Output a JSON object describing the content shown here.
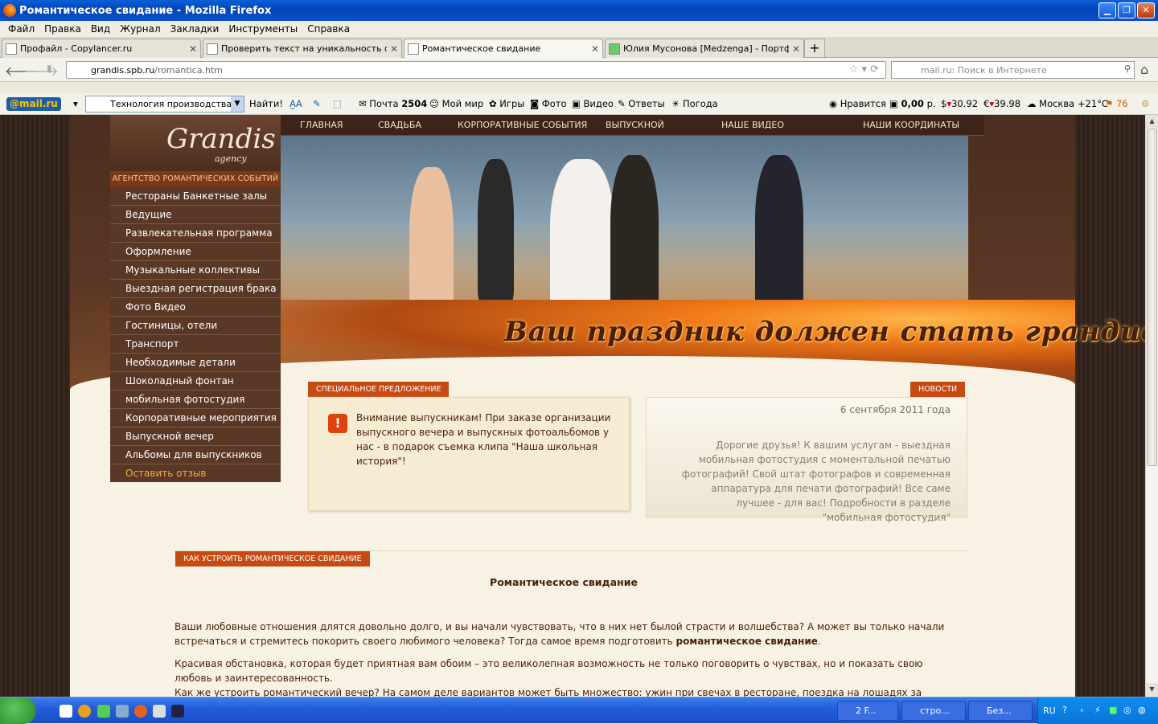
{
  "window": {
    "title": "Романтическое свидание - Mozilla Firefox"
  },
  "menu": [
    "Файл",
    "Правка",
    "Вид",
    "Журнал",
    "Закладки",
    "Инструменты",
    "Справка"
  ],
  "tabs": [
    {
      "label": "Профайл - Copylancer.ru"
    },
    {
      "label": "Проверить текст на уникальность онл..."
    },
    {
      "label": "Романтическое свидание"
    },
    {
      "label": "Юлия Мусонова [Medzenga] - Портфолио"
    }
  ],
  "address": {
    "domain": "grandis.spb.ru",
    "path": "/romantica.htm"
  },
  "search": {
    "placeholder": "mail.ru: Поиск в Интернете"
  },
  "mailru": {
    "logo": "@mail.ru",
    "query": "Технология производства пе",
    "find": "Найти!",
    "mail_label": "Почта",
    "mail_count": "2504",
    "moi_mir": "Мой мир",
    "games": "Игры",
    "photo": "Фото",
    "video": "Видео",
    "answers": "Ответы",
    "weather": "Погода",
    "like": "Нравится",
    "balance": "0,00",
    "balance_unit": "р.",
    "usd": "30.92",
    "eur": "39.98",
    "city": "Москва +21°С",
    "traffic": "76"
  },
  "site": {
    "nav": [
      "ГЛАВНАЯ",
      "СВАДЬБА",
      "КОРПОРАТИВНЫЕ СОБЫТИЯ",
      "ВЫПУСКНОЙ",
      "НАШЕ ВИДЕО",
      "НАШИ КООРДИНАТЫ"
    ],
    "logo": "Grandis",
    "logo_sub": "agency",
    "agency_label": "АГЕНТСТВО РОМАНТИЧЕСКИХ СОБЫТИЙ",
    "sidebar": [
      "Рестораны Банкетные залы",
      "Ведущие",
      "Развлекательная программа",
      "Оформление",
      "Музыкальные коллективы",
      "Выездная регистрация брака",
      "Фото Видео",
      "Гостиницы, отели",
      "Транспорт",
      "Необходимые детали",
      "Шоколадный фонтан",
      "мобильная фотостудия",
      "Корпоративные мероприятия",
      "Выпускной вечер",
      "Альбомы для выпускников"
    ],
    "feedback": "Оставить отзыв",
    "slogan": "Ваш праздник должен стать грандиозным!",
    "special_tag": "СПЕЦИАЛЬНОЕ ПРЕДЛОЖЕНИЕ",
    "special_text": "Внимание выпускникам! При заказе организации выпускного вечера и выпускных фотоальбомов у нас - в подарок съемка клипа \"Наша школьная история\"!",
    "news_tag": "НОВОСТИ",
    "news_date": "6 сентября 2011 года",
    "news_text": "Дорогие друзья! К вашим услугам - выездная мобильная фотостудия с моментальной печатью фотографий! Свой штат фотографов и современная аппаратура для печати фотографий! Все саме лучшее - для вас! Подробности в разделе \"мобильная фотостудия\"",
    "how_tag": "КАК УСТРОИТЬ РОМАНТИЧЕСКОЕ СВИДАНИЕ",
    "content_title": "Романтическое свидание",
    "p1": "Ваши любовные отношения длятся довольно долго, и вы начали чувствовать, что в них нет былой страсти и волшебства? А может вы только начали встречаться и стремитесь покорить своего любимого человека? Тогда самое время подготовить ",
    "p1_bold": "романтическое свидание",
    "p1_end": ".",
    "p2": "Красивая обстановка, которая будет приятная вам обоим – это великолепная возможность не только поговорить о чувствах, но и показать свою любовь и заинтересованность.",
    "p3": "Как же устроить романтический вечер? На самом деле вариантов может быть множество: ужин при свечах в ресторане, поездка на лошадях за городом, прогулка на"
  },
  "taskbar": {
    "firefox": "2 F...",
    "word1": "стро...",
    "word2": "Без...",
    "lang": "RU"
  }
}
